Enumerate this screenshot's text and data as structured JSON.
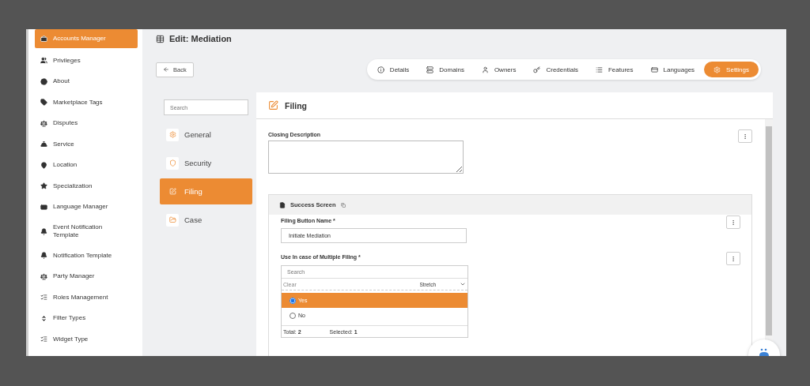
{
  "sidebar": {
    "items": [
      {
        "label": "Accounts Manager",
        "selected": true
      },
      {
        "label": "Privileges",
        "selected": false
      },
      {
        "label": "About",
        "selected": false
      },
      {
        "label": "Marketplace Tags",
        "selected": false
      },
      {
        "label": "Disputes",
        "selected": false
      },
      {
        "label": "Service",
        "selected": false
      },
      {
        "label": "Location",
        "selected": false
      },
      {
        "label": "Specialization",
        "selected": false
      },
      {
        "label": "Language Manager",
        "selected": false
      },
      {
        "label": "Event Notification Template",
        "selected": false
      },
      {
        "label": "Notification Template",
        "selected": false
      },
      {
        "label": "Party Manager",
        "selected": false
      },
      {
        "label": "Roles Management",
        "selected": false
      },
      {
        "label": "Filter Types",
        "selected": false
      },
      {
        "label": "Widget Type",
        "selected": false
      }
    ]
  },
  "page_title": "Edit:  Mediation",
  "back_button": "Back",
  "tabs": [
    {
      "label": "Details",
      "selected": false
    },
    {
      "label": "Domains",
      "selected": false
    },
    {
      "label": "Owners",
      "selected": false
    },
    {
      "label": "Credentials",
      "selected": false
    },
    {
      "label": "Features",
      "selected": false
    },
    {
      "label": "Languages",
      "selected": false
    },
    {
      "label": "Settings",
      "selected": true
    }
  ],
  "settings_nav": {
    "search_placeholder": "Search",
    "items": [
      {
        "label": "General",
        "selected": false
      },
      {
        "label": "Security",
        "selected": false
      },
      {
        "label": "Filing",
        "selected": true
      },
      {
        "label": "Case",
        "selected": false
      }
    ]
  },
  "panel": {
    "title": "Filing",
    "closing_description": {
      "label": "Closing Description"
    },
    "success_screen": {
      "title": "Success Screen",
      "filing_button_name": {
        "label": "Filing Button Name *",
        "value": "Initiate Mediation"
      },
      "multiple_filing": {
        "label": "Use In case of Multiple Filing *",
        "search_placeholder": "Search",
        "clear": "Clear",
        "mode": "Stretch",
        "options": [
          {
            "label": "Yes",
            "selected": true
          },
          {
            "label": "No",
            "selected": false
          }
        ],
        "total_label": "Total:",
        "total": "2",
        "selected_label": "Selected:",
        "selected_count": "1"
      }
    }
  }
}
